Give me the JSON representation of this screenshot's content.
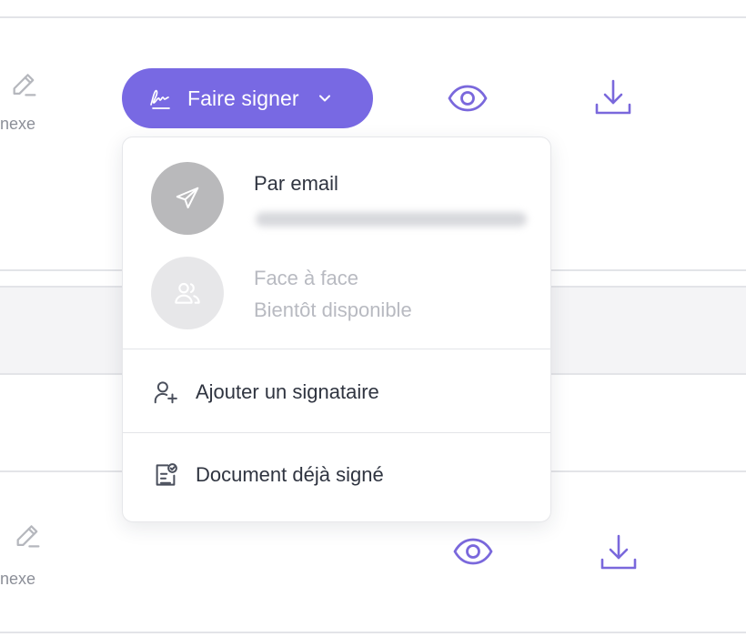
{
  "rows": {
    "annex_label": "nexe"
  },
  "sign_button": {
    "label": "Faire signer",
    "icon": "signature-icon",
    "chevron": "chevron-down-icon"
  },
  "row_actions": {
    "view_icon": "eye-icon",
    "download_icon": "download-icon",
    "edit_icon": "pencil-icon"
  },
  "menu": {
    "email_option": {
      "title": "Par email",
      "icon": "send-icon"
    },
    "face_option": {
      "title": "Face à face",
      "subtitle": "Bientôt disponible",
      "icon": "users-icon"
    },
    "add_signer_label": "Ajouter un signataire",
    "already_signed_label": "Document déjà signé"
  },
  "colors": {
    "accent": "#7869e3",
    "icon_purple": "#7a68dc",
    "muted_text": "#b8bac1",
    "email_circle": "#b9b9bb",
    "face_circle": "#e7e7e9"
  }
}
